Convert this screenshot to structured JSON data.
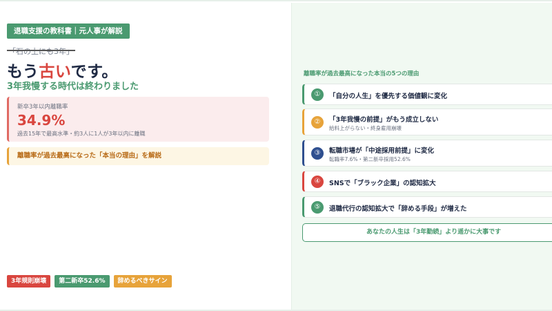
{
  "header": {
    "badge": "退職支援の教科書｜元人事が解説",
    "old_phrase": "「石の上にも3年」",
    "headline_pre": "もう",
    "headline_accent": "古い",
    "headline_post": "です。",
    "subhead": "3年我慢する時代は終わりました"
  },
  "stat": {
    "label": "新卒3年以内離職率",
    "value": "34.9%",
    "note": "過去15年で最高水準・約3人に1人が3年以内に離職"
  },
  "cta": {
    "text": "離職率が過去最高になった「本当の理由」を解説"
  },
  "tags": [
    {
      "label": "3年規則崩壊",
      "color": "#d9463f"
    },
    {
      "label": "第二新卒52.6%",
      "color": "#4a9a70"
    },
    {
      "label": "辞めるべきサイン",
      "color": "#e7a33a"
    }
  ],
  "reasons": {
    "title": "離職率が過去最高になった本当の5つの理由",
    "items": [
      {
        "num": "①",
        "title": "「自分の人生」を優先する価値観に変化",
        "sub": "",
        "color": "#4a9a70"
      },
      {
        "num": "②",
        "title": "「3年我慢の前提」がもう成立しない",
        "sub": "給料上がらない・終身雇用崩壊",
        "color": "#e7a33a"
      },
      {
        "num": "③",
        "title": "転職市場が「中途採用前提」に変化",
        "sub": "転職率7.6%・第二新卒採用52.6%",
        "color": "#2f4f8f"
      },
      {
        "num": "④",
        "title": "SNSで「ブラック企業」の認知拡大",
        "sub": "",
        "color": "#d9463f"
      },
      {
        "num": "⑤",
        "title": "退職代行の認知拡大で「辞める手段」が増えた",
        "sub": "",
        "color": "#4a9a70"
      }
    ],
    "conclusion": "あなたの人生は「3年勤続」より遥かに大事です"
  }
}
